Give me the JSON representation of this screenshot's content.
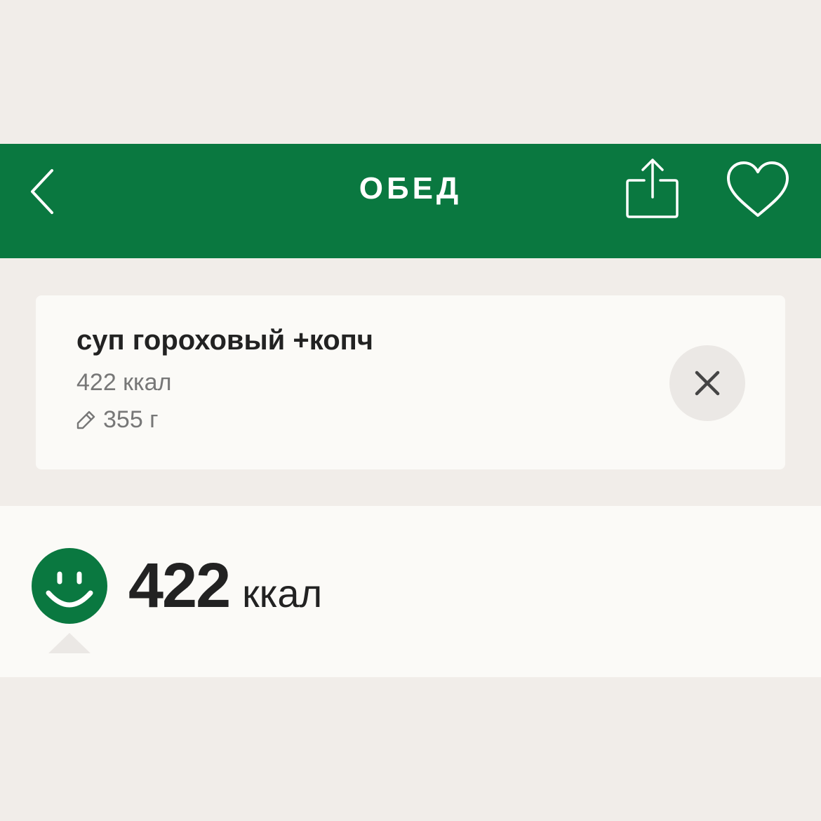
{
  "header": {
    "title": "ОБЕД",
    "back_icon": "chevron-left-icon",
    "share_icon": "share-icon",
    "favorite_icon": "heart-icon",
    "background_color": "#0a7840"
  },
  "food_item": {
    "name": "суп гороховый +копч",
    "calories": "422 ккал",
    "weight": "355 г",
    "edit_icon": "pencil-icon",
    "remove_icon": "close-icon"
  },
  "summary": {
    "total_value": "422",
    "total_unit": "ккал",
    "status_icon": "smiley-icon",
    "status_color": "#0a7840"
  }
}
